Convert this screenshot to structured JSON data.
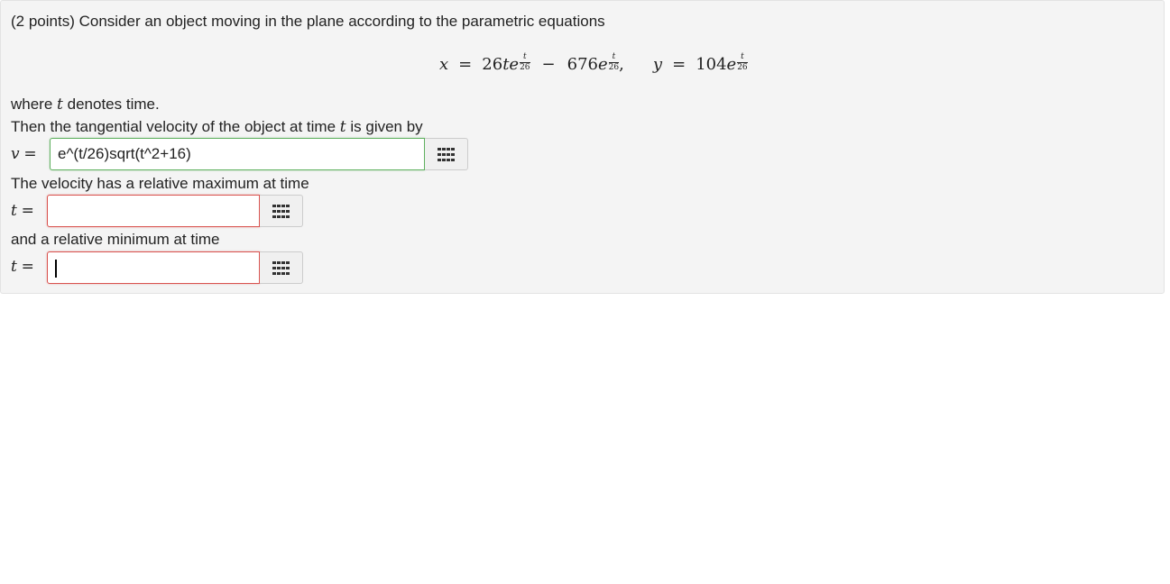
{
  "problem": {
    "intro": "(2 points) Consider an object moving in the plane according to the parametric equations",
    "eq": {
      "x_var": "x",
      "eq1": "=",
      "x_coef1": "26",
      "x_t": "t",
      "x_e1": "e",
      "exp_num": "t",
      "exp_den": "26",
      "minus": "−",
      "x_coef2": "676",
      "x_e2": "e",
      "comma": ",",
      "y_var": "y",
      "eq2": "=",
      "y_coef": "104",
      "y_e": "e"
    },
    "where_prefix": "where",
    "where_var": "t",
    "where_suffix": "denotes time.",
    "then_prefix": "Then the tangential velocity of the object at time",
    "then_var": "t",
    "then_suffix": "is given by",
    "v_label_var": "v",
    "v_label_eq": "=",
    "v_answer": "e^(t/26)sqrt(t^2+16)",
    "max_text": "The velocity has a relative maximum at time",
    "t1_label_var": "t",
    "t1_label_eq": "=",
    "t1_answer": "",
    "min_text": "and a relative minimum at time",
    "t2_label_var": "t",
    "t2_label_eq": "=",
    "t2_answer": ""
  },
  "icons": {
    "keyboard": "grid-keypad-icon"
  },
  "colors": {
    "correct_border": "#5fb05f",
    "incorrect_border": "#d9534f",
    "panel_bg": "#f4f4f4"
  }
}
